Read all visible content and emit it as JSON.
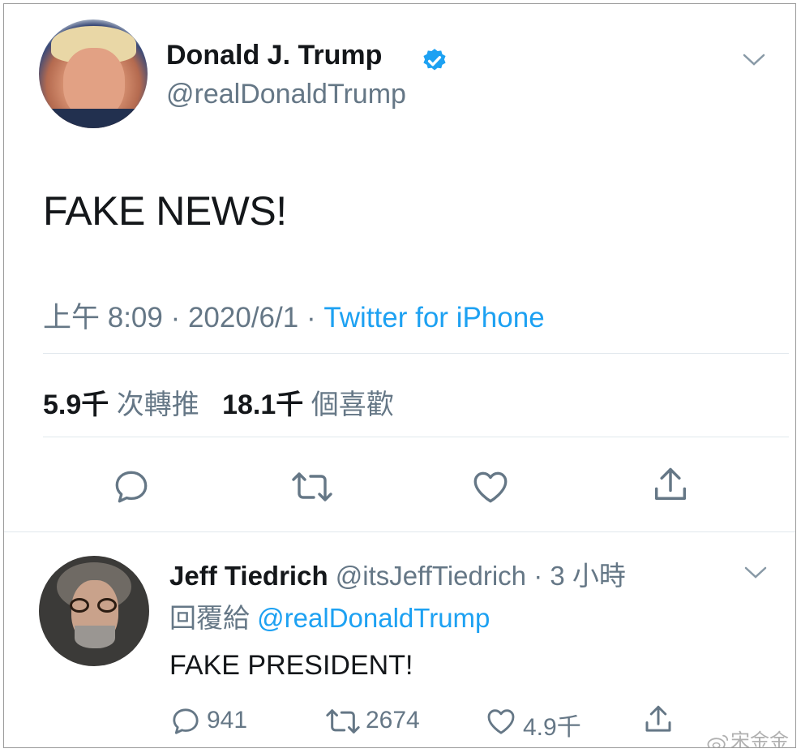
{
  "tweet": {
    "author_name": "Donald J. Trump",
    "author_handle": "@realDonaldTrump",
    "text": "FAKE NEWS!",
    "time": "上午 8:09",
    "date": "2020/6/1",
    "source": "Twitter for iPhone",
    "retweets_count": "5.9千",
    "retweets_label": "次轉推",
    "likes_count": "18.1千",
    "likes_label": "個喜歡"
  },
  "reply": {
    "author_name": "Jeff Tiedrich",
    "author_handle": "@itsJeffTiedrich",
    "age": "3 小時",
    "reply_prefix": "回覆給",
    "reply_to": "@realDonaldTrump",
    "text": "FAKE PRESIDENT!",
    "reply_count": "941",
    "retweet_count": "2674",
    "like_count": "4.9千"
  },
  "watermark": "宋金金",
  "colors": {
    "accent": "#1da1f2",
    "secondary_text": "#657786",
    "primary_text": "#14171a"
  },
  "icons": [
    "verified-badge-icon",
    "chevron-down-icon",
    "reply-icon",
    "retweet-icon",
    "like-icon",
    "share-icon"
  ]
}
